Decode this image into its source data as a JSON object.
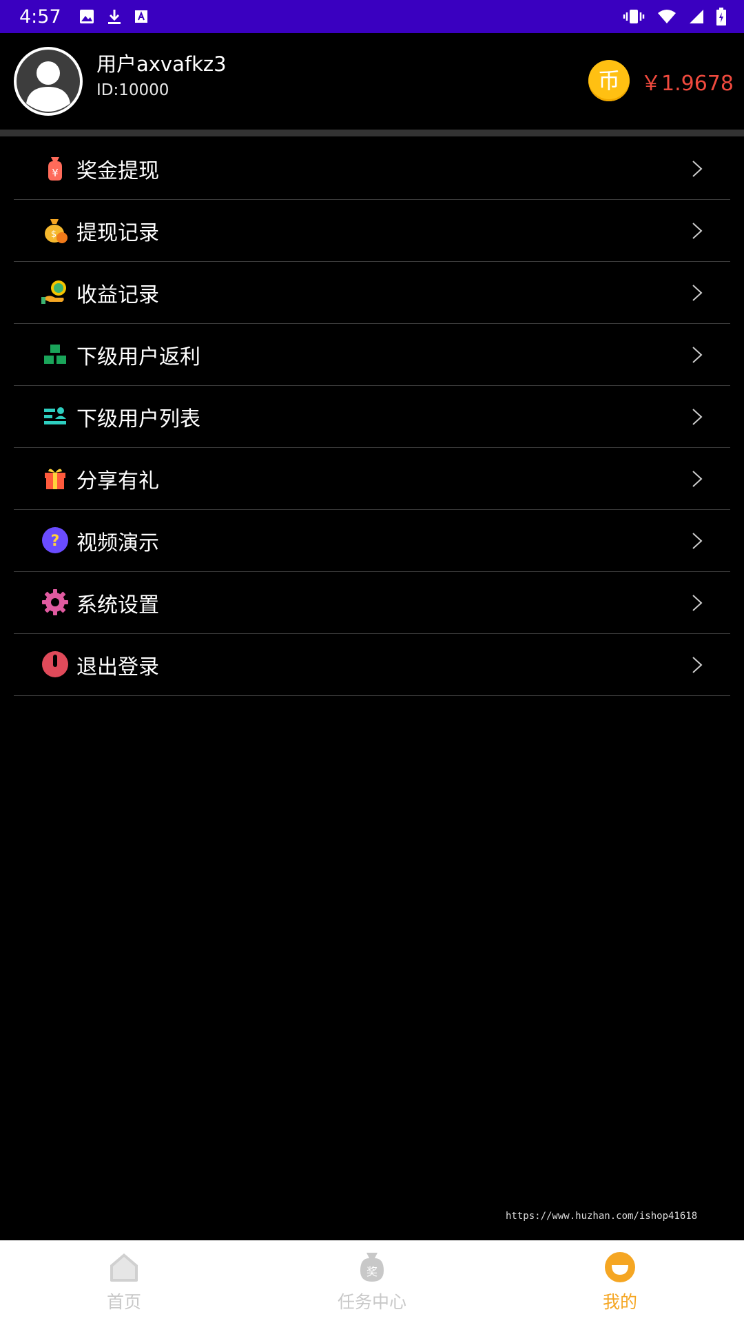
{
  "status_bar": {
    "time": "4:57"
  },
  "profile": {
    "username": "用户axvafkz3",
    "user_id": "ID:10000",
    "coin_glyph": "币",
    "balance": "￥1.9678"
  },
  "menu": {
    "items": [
      {
        "label": "奖金提现",
        "icon": "money-bag-yen-icon"
      },
      {
        "label": "提现记录",
        "icon": "gold-money-bag-icon"
      },
      {
        "label": "收益记录",
        "icon": "hand-coin-icon"
      },
      {
        "label": "下级用户返利",
        "icon": "hierarchy-icon"
      },
      {
        "label": "下级用户列表",
        "icon": "user-list-icon"
      },
      {
        "label": "分享有礼",
        "icon": "gift-icon"
      },
      {
        "label": "视频演示",
        "icon": "question-icon"
      },
      {
        "label": "系统设置",
        "icon": "gear-icon"
      },
      {
        "label": "退出登录",
        "icon": "power-icon"
      }
    ]
  },
  "watermark": "https://www.huzhan.com/ishop41618",
  "tab_bar": {
    "tabs": [
      {
        "label": "首页",
        "icon": "home-icon",
        "active": false
      },
      {
        "label": "任务中心",
        "icon": "reward-bag-icon",
        "active": false
      },
      {
        "label": "我的",
        "icon": "smile-icon",
        "active": true
      }
    ],
    "reward_glyph": "奖"
  },
  "colors": {
    "status_bar": "#3a00c0",
    "accent": "#f5a623",
    "balance": "#f04a3e",
    "coin": "#ffc012"
  }
}
